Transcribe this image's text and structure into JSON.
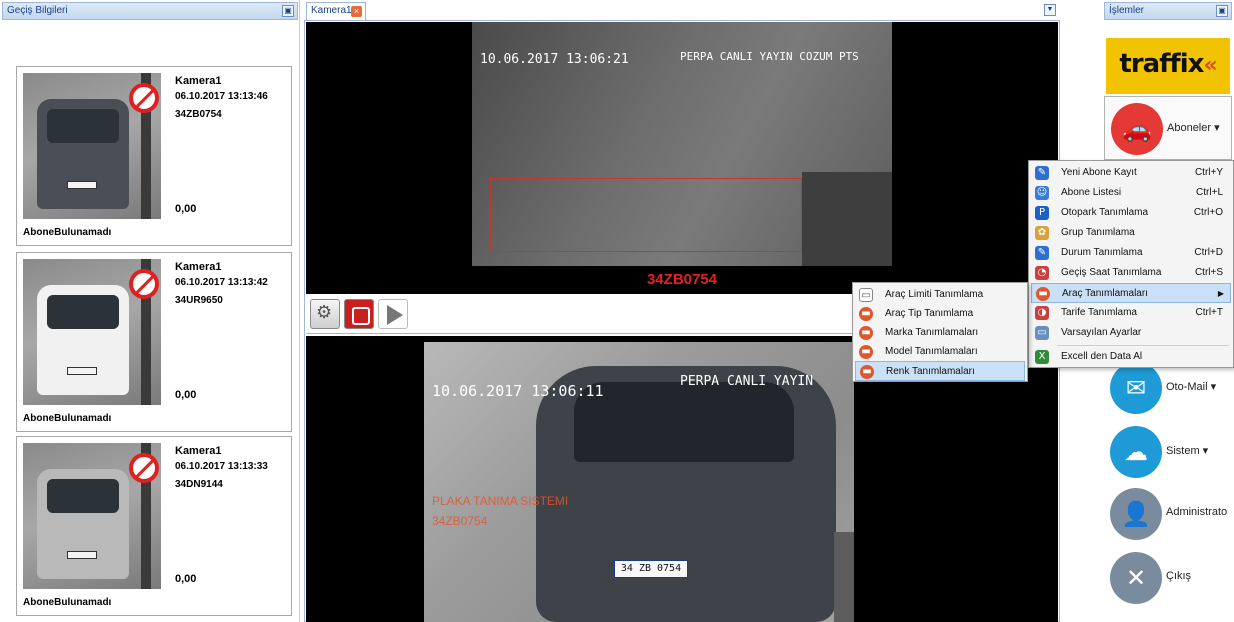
{
  "left_panel": {
    "title": "Geçiş Bilgileri",
    "pin_icon": "pin-icon",
    "cards": [
      {
        "camera": "Kamera1",
        "time": "06.10.2017 13:13:46",
        "plate": "34ZB0754",
        "amount": "0,00",
        "status": "AboneBulunamadı",
        "car_color": "#4a4f55"
      },
      {
        "camera": "Kamera1",
        "time": "06.10.2017 13:13:42",
        "plate": "34UR9650",
        "amount": "0,00",
        "status": "AboneBulunamadı",
        "car_color": "#f1f1f1"
      },
      {
        "camera": "Kamera1",
        "time": "06.10.2017 13:13:33",
        "plate": "34DN9144",
        "amount": "0,00",
        "status": "AboneBulunamadı",
        "car_color": "#b9b9b9"
      }
    ]
  },
  "center": {
    "tab_label": "Kamera1",
    "top_video": {
      "date": "10.06.2017 13:06:21",
      "label": "PERPA CANLI YAYIN COZUM PTS"
    },
    "plate_display": "34ZB0754",
    "bottom_video": {
      "date": "10.06.2017 13:06:11",
      "label": "PERPA CANLI YAYIN",
      "overlay_system": "PLAKA TANIMA SISTEMI",
      "overlay_plate": "34ZB0754",
      "car_plate": "34 ZB 0754"
    }
  },
  "right_panel": {
    "title": "İşlemler",
    "brand": "traffix",
    "buttons": {
      "aboneler": "Aboneler ▾",
      "otomail": "Oto-Mail ▾",
      "sistem": "Sistem ▾",
      "administrator": "Administrato",
      "cikis": "Çıkış"
    }
  },
  "menu": {
    "items": [
      {
        "label": "Yeni Abone Kayıt",
        "shortcut": "Ctrl+Y",
        "icon": "edit-icon",
        "icon_color": "#2f6fcf"
      },
      {
        "label": "Abone Listesi",
        "shortcut": "Ctrl+L",
        "icon": "users-icon",
        "icon_color": "#3a7bd5"
      },
      {
        "label": "Otopark Tanımlama",
        "shortcut": "Ctrl+O",
        "icon": "parking-icon",
        "icon_color": "#1d5fc9"
      },
      {
        "label": "Grup Tanımlama",
        "shortcut": "",
        "icon": "group-icon",
        "icon_color": "#d9a13a"
      },
      {
        "label": "Durum Tanımlama",
        "shortcut": "Ctrl+D",
        "icon": "edit-icon",
        "icon_color": "#2f6fcf"
      },
      {
        "label": "Geçiş Saat Tanımlama",
        "shortcut": "Ctrl+S",
        "icon": "clock-icon",
        "icon_color": "#c94040"
      },
      {
        "label": "Araç Tanımlamaları",
        "shortcut": "",
        "icon": "car-icon",
        "icon_color": "#e0562d"
      },
      {
        "label": "Tarife Tanımlama",
        "shortcut": "Ctrl+T",
        "icon": "tariff-icon",
        "icon_color": "#c94040"
      },
      {
        "label": "Varsayılan Ayarlar",
        "shortcut": "",
        "icon": "settings-icon",
        "icon_color": "#6a8fbf"
      },
      {
        "label": "Excell den Data Al",
        "shortcut": "",
        "icon": "excel-icon",
        "icon_color": "#2e8b3a"
      }
    ],
    "highlighted_index": 6
  },
  "submenu": {
    "items": [
      {
        "label": "Araç Limiti Tanımlama",
        "icon": "limit-icon"
      },
      {
        "label": "Araç Tip Tanımlama",
        "icon": "car-icon"
      },
      {
        "label": "Marka Tanımlamaları",
        "icon": "car-icon"
      },
      {
        "label": "Model Tanımlamaları",
        "icon": "car-icon"
      },
      {
        "label": "Renk Tanımlamaları",
        "icon": "car-icon"
      }
    ],
    "highlighted_index": 4
  },
  "colors": {
    "accent": "#15428b",
    "plate_red": "#e32222",
    "highlight": "#c9e0f7"
  }
}
